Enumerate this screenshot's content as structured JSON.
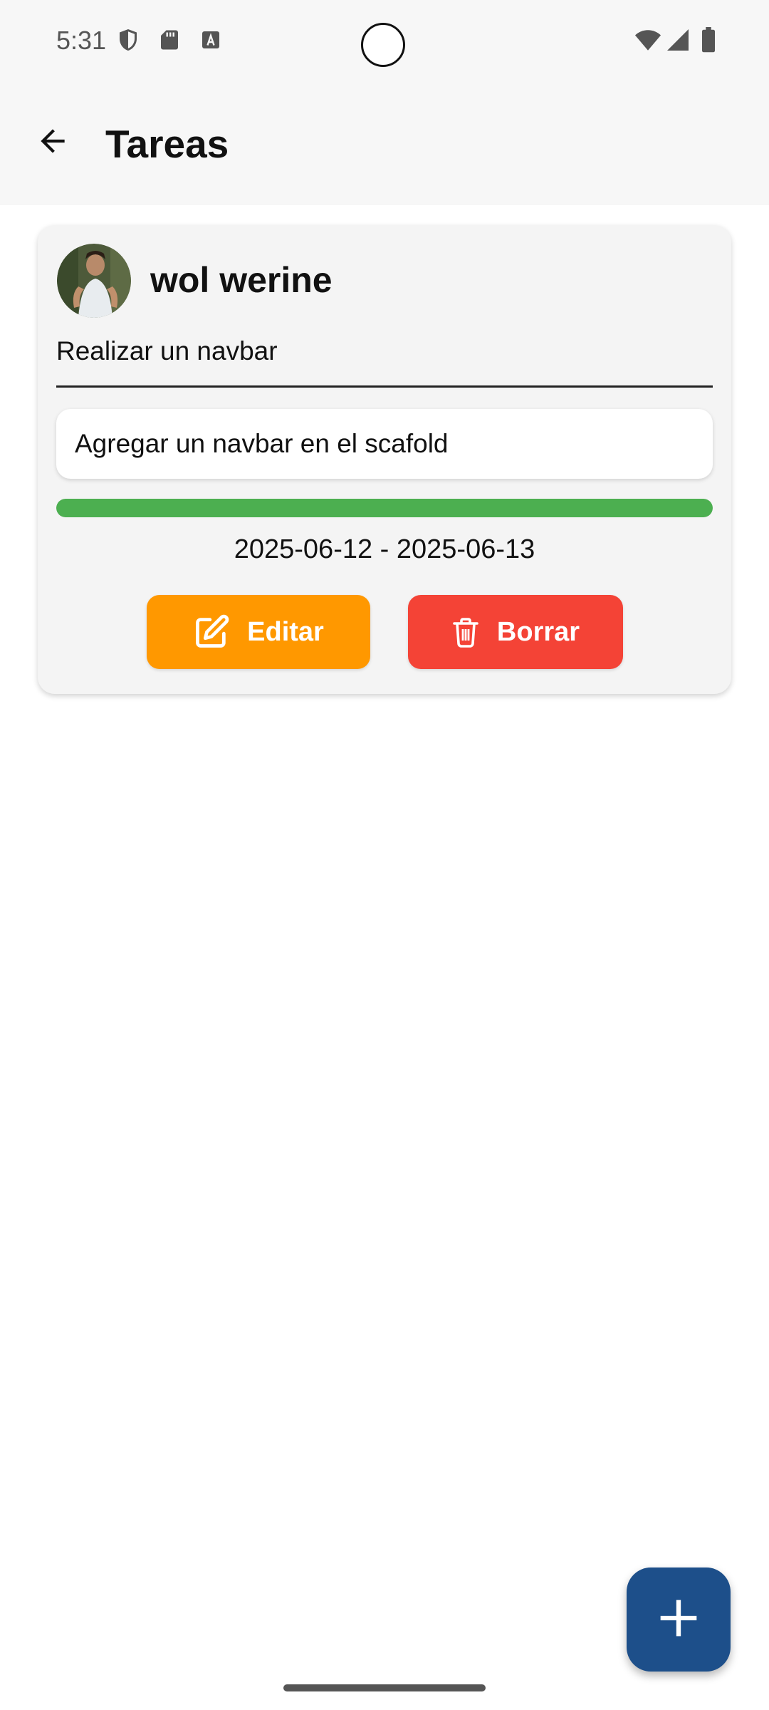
{
  "status_bar": {
    "time": "5:31",
    "left_icons": [
      "shield-icon",
      "sd-card-icon",
      "font-icon"
    ],
    "right_icons": [
      "wifi-icon",
      "cell-signal-icon",
      "battery-icon"
    ]
  },
  "app_bar": {
    "title": "Tareas",
    "back_icon": "arrow-back-icon"
  },
  "tasks": [
    {
      "user_name": "wol werine",
      "title": "Realizar un navbar",
      "description": "Agregar un navbar en el scafold",
      "progress": 1.0,
      "date_range": "2025-06-12 - 2025-06-13",
      "edit_label": "Editar",
      "delete_label": "Borrar"
    }
  ],
  "fab": {
    "icon": "plus-icon"
  },
  "colors": {
    "progress": "#4caf50",
    "edit_button": "#ff9800",
    "delete_button": "#f44336",
    "fab": "#1d4f8a"
  }
}
